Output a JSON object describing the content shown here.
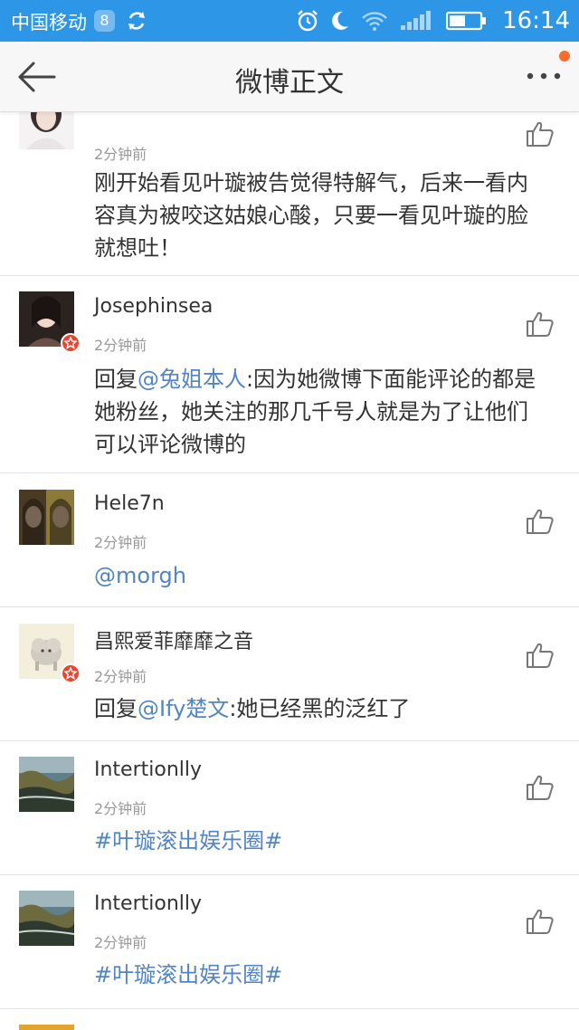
{
  "status_bar": {
    "carrier": "中国移动",
    "badge": "8",
    "time": "16:14"
  },
  "header": {
    "title": "微博正文"
  },
  "comments": [
    {
      "username": "",
      "time": "2分钟前",
      "text": "刚开始看见叶璇被告觉得特解气，后来一看内容真为被咬这姑娘心酸，只要一看见叶璇的脸就想吐！"
    },
    {
      "username": "Josephinsea",
      "time": "2分钟前",
      "text_prefix": "回复",
      "mention": "@兔姐本人",
      "text": ":因为她微博下面能评论的都是她粉丝，她关注的那几千号人就是为了让他们可以评论微博的"
    },
    {
      "username": "Hele7n",
      "time": "2分钟前",
      "mention": "@morgh"
    },
    {
      "username": "昌熙爱菲靡靡之音",
      "time": "2分钟前",
      "text_prefix": "回复",
      "mention": "@Ify楚文",
      "text": ":她已经黑的泛红了"
    },
    {
      "username": "Intertionlly",
      "time": "2分钟前",
      "topic": "#叶璇滚出娱乐圈#"
    },
    {
      "username": "Intertionlly",
      "time": "2分钟前",
      "topic": "#叶璇滚出娱乐圈#"
    }
  ],
  "colors": {
    "status_bar": "#2d96e6",
    "link": "#5285c2",
    "verified_badge": "#e9462f",
    "notification_dot": "#fb6a30"
  },
  "icons": {
    "back": "arrow-left-icon",
    "more": "more-dots-icon",
    "like": "thumbs-up-icon",
    "verified": "star-badge-icon",
    "alarm": "alarm-clock-icon",
    "moon": "moon-icon",
    "wifi": "wifi-icon",
    "signal": "signal-icon",
    "battery": "battery-icon"
  }
}
